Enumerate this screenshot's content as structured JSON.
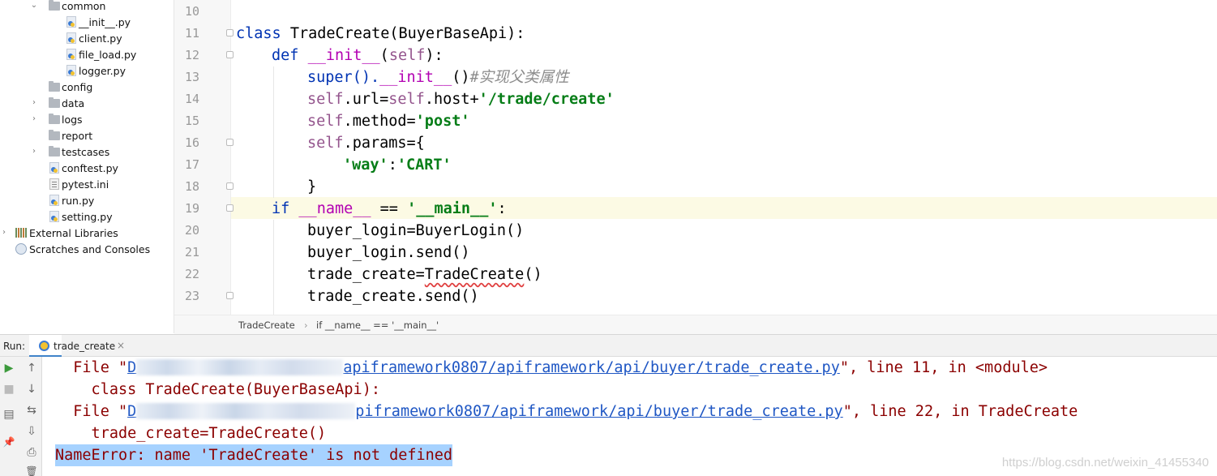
{
  "project_tree": {
    "items": [
      {
        "label": "common",
        "type": "folder",
        "expanded": true
      },
      {
        "label": "__init__.py",
        "type": "py"
      },
      {
        "label": "client.py",
        "type": "py"
      },
      {
        "label": "file_load.py",
        "type": "py"
      },
      {
        "label": "logger.py",
        "type": "py"
      },
      {
        "label": "config",
        "type": "folder"
      },
      {
        "label": "data",
        "type": "folder",
        "collapsed": true
      },
      {
        "label": "logs",
        "type": "folder",
        "collapsed": true
      },
      {
        "label": "report",
        "type": "folder"
      },
      {
        "label": "testcases",
        "type": "folder",
        "collapsed": true
      },
      {
        "label": "conftest.py",
        "type": "py"
      },
      {
        "label": "pytest.ini",
        "type": "ini"
      },
      {
        "label": "run.py",
        "type": "py"
      },
      {
        "label": "setting.py",
        "type": "py"
      },
      {
        "label": "External Libraries",
        "type": "library"
      },
      {
        "label": "Scratches and Consoles",
        "type": "scratch"
      }
    ]
  },
  "editor": {
    "line_numbers": [
      "10",
      "11",
      "12",
      "13",
      "14",
      "15",
      "16",
      "17",
      "18",
      "19",
      "20",
      "21",
      "22",
      "23"
    ],
    "code": {
      "l11_kw": "class",
      "l11_rest": " TradeCreate(BuyerBaseApi):",
      "l12_kw": "def",
      "l12_name": "__init__",
      "l12_open": "(",
      "l12_self": "self",
      "l12_close": "):",
      "l13_super": "super().",
      "l13_init": "__init__",
      "l13_call": "()",
      "l13_comment": "#实现父类属性",
      "l14_self1": "self",
      "l14_mid": ".url=",
      "l14_self2": "self",
      "l14_host": ".host+",
      "l14_str": "'/trade/create'",
      "l15_self": "self",
      "l15_mid": ".method=",
      "l15_str": "'post'",
      "l16_self": "self",
      "l16_mid": ".params={",
      "l17_key": "'way'",
      "l17_colon": ":",
      "l17_val": "'CART'",
      "l18": "}",
      "l19_kw": "if",
      "l19_name": "__name__",
      "l19_eq": " == ",
      "l19_str": "'__main__'",
      "l19_colon": ":",
      "l20": "buyer_login=BuyerLogin()",
      "l21": "buyer_login.send()",
      "l22_a": "trade_create=",
      "l22_b": "TradeCreate",
      "l22_c": "()",
      "l23": "trade_create.send()"
    }
  },
  "breadcrumb": {
    "item1": "TradeCreate",
    "sep": "›",
    "item2": "if __name__ == '__main__'"
  },
  "run_panel": {
    "label": "Run:",
    "tab_label": "trade_create",
    "tab_close": "×",
    "toolbar": {
      "run_icon": "▶",
      "up_icon": "↑",
      "stop_icon": "■",
      "down_icon": "↓",
      "wrap_icon": "⇆",
      "layout_icon": "▤",
      "scroll_icon": "⇩",
      "pin_icon": "📌",
      "print_icon": "⎙",
      "trash_icon": "🗑"
    },
    "console": {
      "line1_prefix": "  File \"",
      "line1_link_start": "D",
      "line1_link_end": "apiframework0807/apiframework/api/buyer/trade_create.py",
      "line1_suffix": "\", line 11, in <module>",
      "line2": "    class TradeCreate(BuyerBaseApi):",
      "line3_prefix": "  File \"",
      "line3_link_start": "D",
      "line3_link_end": "piframework0807/apiframework/api/buyer/trade_create.py",
      "line3_suffix": "\", line 22, in TradeCreate",
      "line4": "    trade_create=TradeCreate()",
      "error": "NameError: name 'TradeCreate' is not defined"
    }
  },
  "watermark": "https://blog.csdn.net/weixin_41455340",
  "colors": {
    "keyword": "#0033b3",
    "self": "#94558d",
    "string": "#067d17",
    "dunder": "#b200b2",
    "comment": "#8c8c8c",
    "console_text": "#8b0000",
    "console_link": "#1f57c4",
    "error_highlight": "#a6d2ff",
    "current_line": "#fcfae4"
  }
}
